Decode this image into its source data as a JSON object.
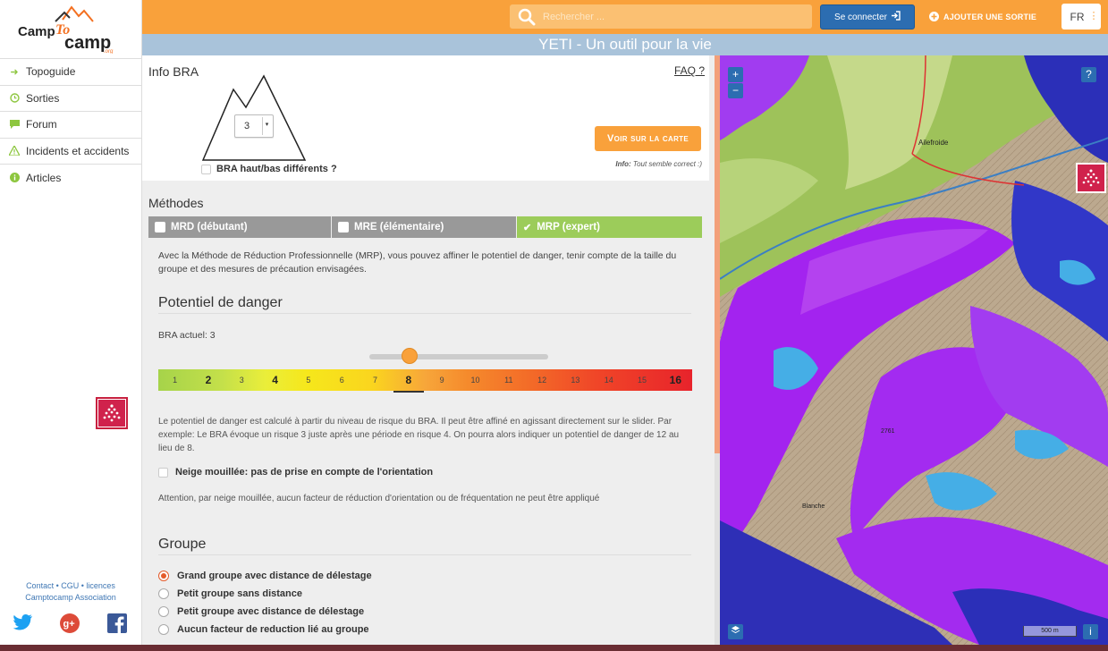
{
  "app": {
    "logo_text": "camptocamp.org",
    "page_title": "YETI - Un outil pour la vie"
  },
  "sidebar": {
    "items": [
      {
        "label": "Topoguide",
        "icon": "arrow-right-icon"
      },
      {
        "label": "Sorties",
        "icon": "clock-icon"
      },
      {
        "label": "Forum",
        "icon": "comment-icon"
      },
      {
        "label": "Incidents et accidents",
        "icon": "warning-icon"
      },
      {
        "label": "Articles",
        "icon": "info-icon"
      }
    ],
    "footer": {
      "contact": "Contact",
      "cgu": "CGU",
      "licences": "licences",
      "association": "Camptocamp Association"
    }
  },
  "topbar": {
    "search_placeholder": "Rechercher ...",
    "login_label": "Se connecter",
    "add_label": "Ajouter une sortie",
    "lang": "FR"
  },
  "info_bra": {
    "title": "Info BRA",
    "faq": "FAQ ?",
    "bra_value": "3",
    "diff_label": "BRA haut/bas différents ?",
    "map_button": "Voir sur la carte",
    "note_prefix": "Info:",
    "note_text": "Tout semble correct :)"
  },
  "methodes": {
    "title": "Méthodes",
    "tabs": [
      {
        "label": "MRD (débutant)",
        "active": false
      },
      {
        "label": "MRE (élémentaire)",
        "active": false
      },
      {
        "label": "MRP (expert)",
        "active": true
      }
    ],
    "description": "Avec la Méthode de Réduction Professionnelle (MRP), vous pouvez affiner le potentiel de danger, tenir compte de la taille du groupe et des mesures de précaution envisagées."
  },
  "potentiel": {
    "title": "Potentiel de danger",
    "bra_actuel": "BRA actuel: 3",
    "slider_value": 8,
    "scale": [
      "1",
      "2",
      "3",
      "4",
      "5",
      "6",
      "7",
      "8",
      "9",
      "10",
      "11",
      "12",
      "13",
      "14",
      "15",
      "16"
    ],
    "paragraph": "Le potentiel de danger est calculé à partir du niveau de risque du BRA. Il peut être affiné en agissant directement sur le slider. Par exemple: Le BRA évoque un risque 3 juste après une période en risque 4. On pourra alors indiquer un potentiel de danger de 12 au lieu de 8.",
    "neige_label": "Neige mouillée: pas de prise en compte de l'orientation",
    "attention": "Attention, par neige mouillée, aucun facteur de réduction d'orientation ou de fréquentation ne peut être appliqué"
  },
  "groupe": {
    "title": "Groupe",
    "options": [
      {
        "label": "Grand groupe avec distance de délestage",
        "selected": true
      },
      {
        "label": "Petit groupe sans distance",
        "selected": false
      },
      {
        "label": "Petit groupe avec distance de délestage",
        "selected": false
      },
      {
        "label": "Aucun facteur de reduction lié au groupe",
        "selected": false
      }
    ]
  },
  "map": {
    "zoom_in": "+",
    "zoom_out": "−",
    "help": "?",
    "info": "i",
    "scale": "500 m",
    "labels": [
      "Ailefroide",
      "Blanche",
      "2761"
    ]
  },
  "colors": {
    "orange": "#f9a13b",
    "blue": "#2c6db1",
    "green": "#9ccc5a",
    "danger_purple": "#a020f0"
  }
}
